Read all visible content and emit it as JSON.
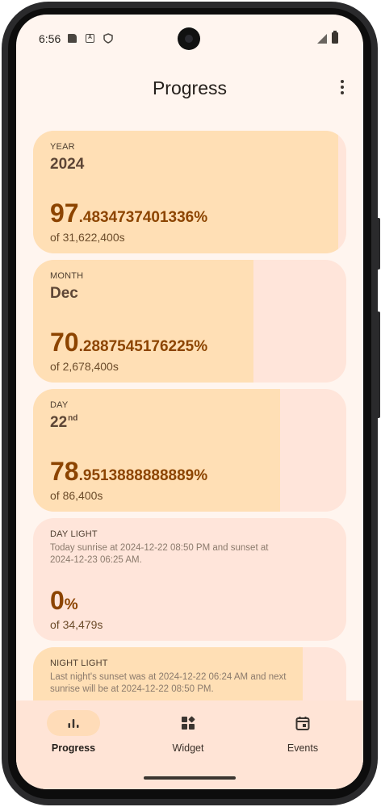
{
  "status_bar": {
    "time": "6:56"
  },
  "app_bar": {
    "title": "Progress"
  },
  "cards": [
    {
      "label": "YEAR",
      "heading": "2024",
      "progress_percent": 97.4834737401336,
      "percent_int": "97",
      "percent_frac": ".4834737401336%",
      "of": "of 31,622,400s"
    },
    {
      "label": "MONTH",
      "heading": "Dec",
      "progress_percent": 70.2887545176225,
      "percent_int": "70",
      "percent_frac": ".2887545176225%",
      "of": "of 2,678,400s"
    },
    {
      "label": "DAY",
      "heading": "22",
      "heading_suffix": "nd",
      "progress_percent": 78.9513888888889,
      "percent_int": "78",
      "percent_frac": ".9513888888889%",
      "of": "of 86,400s"
    },
    {
      "label": "DAY LIGHT",
      "description": "Today sunrise at 2024-12-22 08:50 PM and sunset at 2024-12-23 06:25 AM.",
      "progress_percent": 0,
      "percent_int": "0",
      "percent_frac": "%",
      "of": "of 34,479s"
    },
    {
      "label": "NIGHT LIGHT",
      "description": "Last night's sunset was at 2024-12-22 06:24 AM and next sunrise will be at 2024-12-22 08:50 PM.",
      "progress_percent": 86
    }
  ],
  "nav": {
    "items": [
      {
        "label": "Progress",
        "icon": "bar-chart-icon",
        "active": true
      },
      {
        "label": "Widget",
        "icon": "widgets-icon",
        "active": false
      },
      {
        "label": "Events",
        "icon": "calendar-icon",
        "active": false
      }
    ]
  },
  "colors": {
    "background": "#fff5ef",
    "card": "#ffe5da",
    "card_fill": "#ffdfb5",
    "accent": "#8c4400",
    "nav_background": "#ffe4d6",
    "nav_active_pill": "#ffdcb8"
  }
}
